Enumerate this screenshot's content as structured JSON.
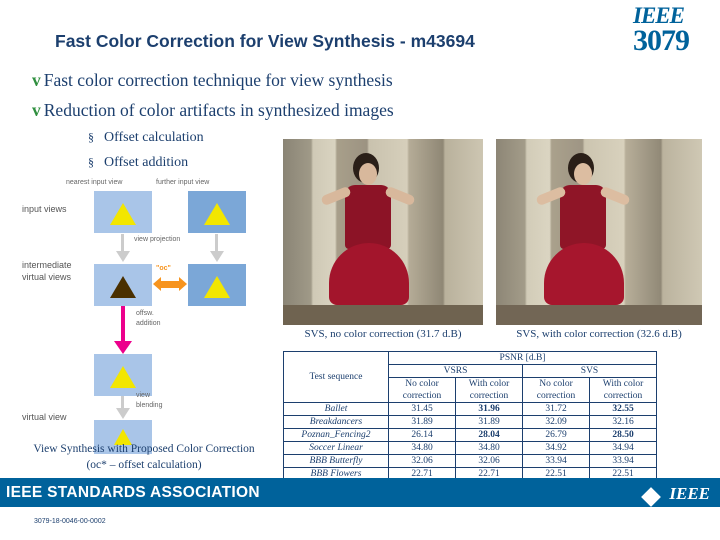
{
  "slide": {
    "title": "Fast Color Correction for View Synthesis - m43694",
    "doc_id": "3079-18-0046-00-0002"
  },
  "logo": {
    "word": "IEEE",
    "number": "3079"
  },
  "bullets": [
    {
      "mark": "v",
      "text": "Fast color correction technique for view synthesis"
    },
    {
      "mark": "v",
      "text": "Reduction of color artifacts in synthesized images"
    }
  ],
  "sub_bullets": [
    {
      "mark": "§",
      "text": "Offset calculation"
    },
    {
      "mark": "§",
      "text": "Offset addition"
    }
  ],
  "diagram": {
    "labels": [
      "input views",
      "intermediate",
      "virtual views",
      "virtual view"
    ],
    "small_labels": [
      "nearest input view",
      "further input view",
      "view projection",
      "\"oc\"",
      "offsw.",
      "addition",
      "view",
      "blending"
    ],
    "caption_line1": "View Synthesis with Proposed Color Correction",
    "caption_line2": "(oc* – offset calculation)"
  },
  "images": {
    "left_caption": "SVS, no color correction (31.7 d.B)",
    "right_caption": "SVS, with color correction (32.6 d.B)"
  },
  "chart_data": {
    "type": "table",
    "title": "PSNR [d.B]",
    "col_group_header": "PSNR [d.B]",
    "groups": [
      "VSRS",
      "SVS"
    ],
    "row_header": "Test sequence",
    "columns": [
      "No color correction",
      "With color correction",
      "No color correction",
      "With color correction"
    ],
    "categories": [
      "Ballet",
      "Breakdancers",
      "Poznan_Fencing2",
      "Soccer Linear",
      "BBB Butterfly",
      "BBB Flowers"
    ],
    "rows": [
      {
        "sequence": "Ballet",
        "values": [
          "31.45",
          "31.96",
          "31.72",
          "32.55"
        ],
        "bold": [
          false,
          true,
          false,
          true
        ]
      },
      {
        "sequence": "Breakdancers",
        "values": [
          "31.89",
          "31.89",
          "32.09",
          "32.16"
        ],
        "bold": [
          false,
          false,
          false,
          false
        ]
      },
      {
        "sequence": "Poznan_Fencing2",
        "values": [
          "26.14",
          "28.04",
          "26.79",
          "28.50"
        ],
        "bold": [
          false,
          true,
          false,
          true
        ]
      },
      {
        "sequence": "Soccer Linear",
        "values": [
          "34.80",
          "34.80",
          "34.92",
          "34.94"
        ],
        "bold": [
          false,
          false,
          false,
          false
        ]
      },
      {
        "sequence": "BBB Butterfly",
        "values": [
          "32.06",
          "32.06",
          "33.94",
          "33.94"
        ],
        "bold": [
          false,
          false,
          false,
          false
        ]
      },
      {
        "sequence": "BBB Flowers",
        "values": [
          "22.71",
          "22.71",
          "22.51",
          "22.51"
        ],
        "bold": [
          false,
          false,
          false,
          false
        ]
      }
    ]
  },
  "footer": {
    "association": "IEEE STANDARDS ASSOCIATION",
    "brand": "IEEE"
  },
  "colors": {
    "brand_blue": "#00629b",
    "title_blue": "#1c3f6e",
    "bullet_green": "#2f8f3f",
    "accent_yellow": "#f2e600",
    "accent_pink": "#ec008c",
    "accent_orange": "#f7941e",
    "box_blue": "#a9c5e8"
  }
}
